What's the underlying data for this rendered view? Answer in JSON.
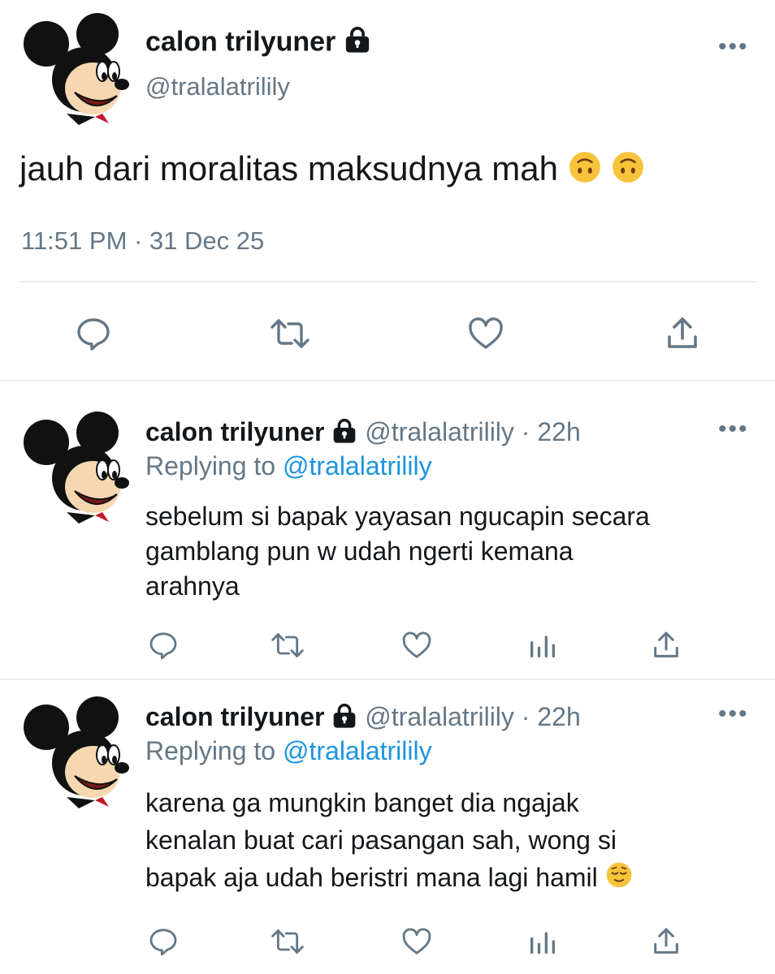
{
  "main_tweet": {
    "display_name": "calon trilyuner",
    "handle": "@tralalatrilily",
    "text": "jauh dari moralitas maksudnya mah",
    "emoji_names": [
      "upside-down-face-emoji",
      "upside-down-face-emoji"
    ],
    "timestamp": "11:51 PM · 31 Dec 25"
  },
  "replies": [
    {
      "display_name": "calon trilyuner",
      "handle": "@tralalatrilily",
      "time": "· 22h",
      "replying_to_label": "Replying to",
      "replying_to_handle": "@tralalatrilily",
      "lines": [
        "sebelum si bapak yayasan ngucapin secara",
        "gamblang pun w udah ngerti kemana",
        "arahnya"
      ]
    },
    {
      "display_name": "calon trilyuner",
      "handle": "@tralalatrilily",
      "time": "· 22h",
      "replying_to_label": "Replying to",
      "replying_to_handle": "@tralalatrilily",
      "lines": [
        "karena ga mungkin banget dia ngajak",
        "kenalan buat cari pasangan sah, wong si",
        "bapak aja udah beristri mana lagi hamil"
      ],
      "emoji_names": [
        "relieved-face-emoji"
      ]
    }
  ],
  "more_label": "•••",
  "colors": {
    "text": "#14171a",
    "muted": "#657786",
    "link": "#1b95e0",
    "divider": "#e6ecf0"
  }
}
